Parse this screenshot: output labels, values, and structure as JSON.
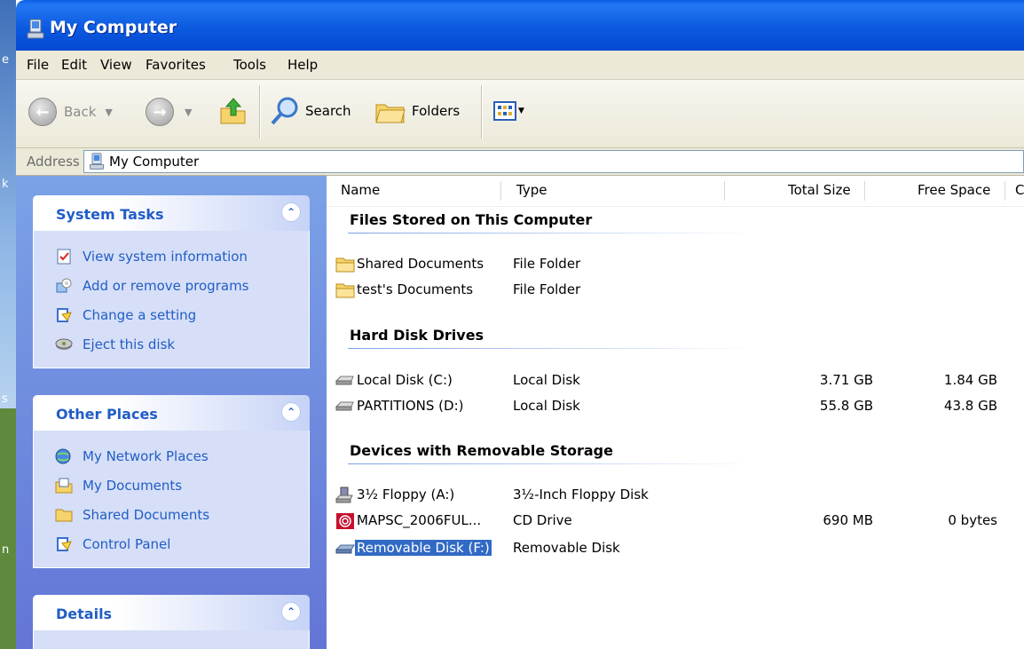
{
  "window": {
    "title": "My Computer"
  },
  "desktop_edge": {
    "glyphs": [
      "e",
      "k",
      "s",
      "n"
    ]
  },
  "menu": [
    "File",
    "Edit",
    "View",
    "Favorites",
    "Tools",
    "Help"
  ],
  "toolbar": {
    "back": "Back",
    "search": "Search",
    "folders": "Folders"
  },
  "address": {
    "label": "Address",
    "value": "My Computer"
  },
  "taskpane": {
    "system_tasks": {
      "title": "System Tasks",
      "items": [
        {
          "label": "View system information",
          "icon": "system-info-icon"
        },
        {
          "label": "Add or remove programs",
          "icon": "add-remove-icon"
        },
        {
          "label": "Change a setting",
          "icon": "control-panel-icon"
        },
        {
          "label": "Eject this disk",
          "icon": "eject-disk-icon"
        }
      ]
    },
    "other_places": {
      "title": "Other Places",
      "items": [
        {
          "label": "My Network Places",
          "icon": "network-icon"
        },
        {
          "label": "My Documents",
          "icon": "documents-icon"
        },
        {
          "label": "Shared Documents",
          "icon": "folder-icon"
        },
        {
          "label": "Control Panel",
          "icon": "control-panel-icon"
        }
      ]
    },
    "details": {
      "title": "Details"
    }
  },
  "columns": {
    "name": "Name",
    "type": "Type",
    "total": "Total Size",
    "free": "Free Space",
    "extra": "C"
  },
  "groups": {
    "files": {
      "title": "Files Stored on This Computer",
      "rows": [
        {
          "name": "Shared Documents",
          "type": "File Folder"
        },
        {
          "name": "test's Documents",
          "type": "File Folder"
        }
      ]
    },
    "hdd": {
      "title": "Hard Disk Drives",
      "rows": [
        {
          "name": "Local Disk (C:)",
          "type": "Local Disk",
          "total": "3.71 GB",
          "free": "1.84 GB"
        },
        {
          "name": "PARTITIONS (D:)",
          "type": "Local Disk",
          "total": "55.8 GB",
          "free": "43.8 GB"
        }
      ]
    },
    "removable": {
      "title": "Devices with Removable Storage",
      "rows": [
        {
          "name": "3½ Floppy (A:)",
          "type": "3½-Inch Floppy Disk"
        },
        {
          "name": "MAPSC_2006FUL...",
          "type": "CD Drive",
          "total": "690 MB",
          "free": "0 bytes"
        },
        {
          "name": "Removable Disk (F:)",
          "type": "Removable Disk",
          "selected": true
        }
      ]
    }
  },
  "colors": {
    "title_blue": "#0a5de8",
    "link_blue": "#215dc6",
    "selection": "#316ac5",
    "pane": "#6375d6"
  }
}
